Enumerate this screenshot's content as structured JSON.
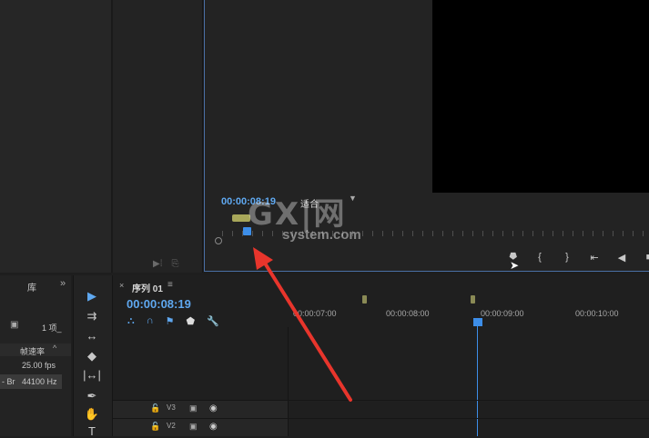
{
  "program_monitor": {
    "timecode": "00:00:08:19",
    "fit_label": "适合",
    "transport": [
      {
        "label": "⯂",
        "icon": "add-marker-icon"
      },
      {
        "label": "{",
        "icon": "mark-in-icon"
      },
      {
        "label": "}",
        "icon": "mark-out-icon"
      },
      {
        "label": "⇤",
        "icon": "go-to-in-icon"
      },
      {
        "label": "◀",
        "icon": "step-back-icon"
      },
      {
        "label": "■",
        "icon": "stop-icon"
      }
    ]
  },
  "project_panel": {
    "tab_label": "库",
    "more_label": "»",
    "item_count": "1 项_",
    "column_header": "帧速率",
    "sort_icon": "^",
    "fps_value": "25.00 fps",
    "audio_label": "- Br",
    "audio_rate": "44100 Hz"
  },
  "tools": [
    {
      "glyph": "▶",
      "icon": "selection-tool-icon"
    },
    {
      "glyph": "⇉",
      "icon": "track-select-tool-icon"
    },
    {
      "glyph": "↔",
      "icon": "ripple-edit-tool-icon"
    },
    {
      "glyph": "◆",
      "icon": "razor-tool-icon"
    },
    {
      "glyph": "|↔|",
      "icon": "slip-tool-icon"
    },
    {
      "glyph": "✒",
      "icon": "pen-tool-icon"
    },
    {
      "glyph": "✋",
      "icon": "hand-tool-icon"
    },
    {
      "glyph": "T",
      "icon": "type-tool-icon"
    }
  ],
  "timeline": {
    "close": "×",
    "sequence_name": "序列 01",
    "menu": "≡",
    "timecode": "00:00:08:19",
    "time_labels": [
      "00:00:07:00",
      "00:00:08:00",
      "00:00:09:00",
      "00:00:10:00"
    ],
    "tracks": [
      {
        "name": "V3"
      },
      {
        "name": "V2"
      }
    ]
  },
  "watermark": {
    "logo": "GX|网",
    "text": "system.com"
  }
}
